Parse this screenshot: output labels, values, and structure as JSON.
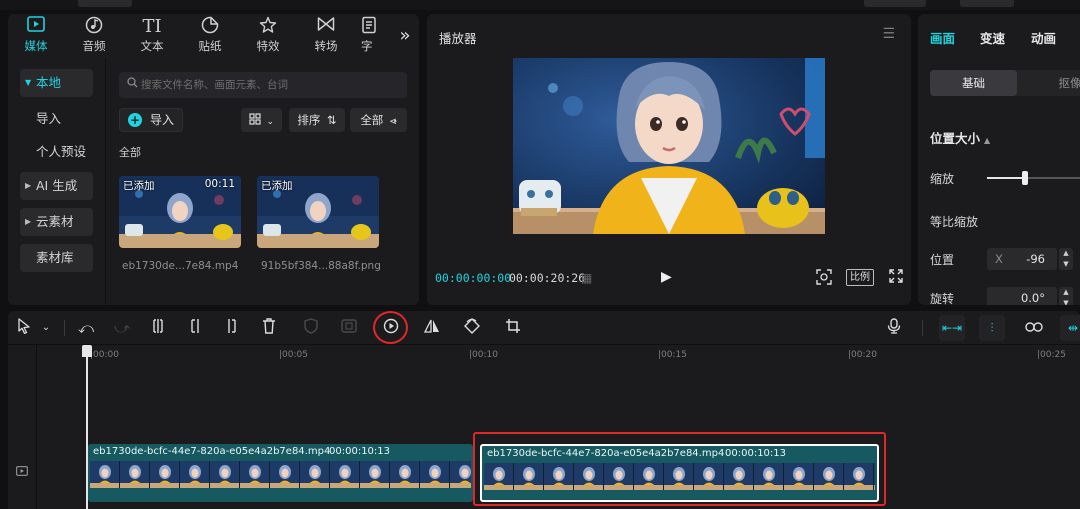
{
  "media_panel": {
    "tabs": [
      {
        "label": "媒体",
        "icon": "media-icon",
        "active": true
      },
      {
        "label": "音频",
        "icon": "audio-icon"
      },
      {
        "label": "文本",
        "icon": "text-icon"
      },
      {
        "label": "贴纸",
        "icon": "sticker-icon"
      },
      {
        "label": "特效",
        "icon": "effects-icon"
      },
      {
        "label": "转场",
        "icon": "transition-icon"
      },
      {
        "label": "字",
        "icon": "caption-icon"
      }
    ],
    "sidebar": [
      {
        "label": "本地",
        "active": true
      },
      {
        "label": "导入"
      },
      {
        "label": "个人预设"
      },
      {
        "label": "AI 生成"
      },
      {
        "label": "云素材"
      },
      {
        "label": "素材库"
      }
    ],
    "search_placeholder": "搜索文件名称、画面元素、台词",
    "import_label": "导入",
    "sort_label": "排序",
    "filter_label": "全部",
    "section_label": "全部",
    "items": [
      {
        "tag": "已添加",
        "duration": "00:11",
        "filename": "eb1730de...7e84.mp4"
      },
      {
        "tag": "已添加",
        "duration": "",
        "filename": "91b5bf384...88a8f.png"
      }
    ]
  },
  "player": {
    "title": "播放器",
    "current_time": "00:00:00:00",
    "total_time": "00:00:20:26",
    "ratio_label": "比例"
  },
  "inspector": {
    "tabs": [
      "画面",
      "变速",
      "动画"
    ],
    "subtabs": [
      "基础",
      "抠像"
    ],
    "section_title": "位置大小",
    "scale_label": "缩放",
    "scale_value_fraction": 0.38,
    "uniform_scale_label": "等比缩放",
    "position_label": "位置",
    "position_x_key": "X",
    "position_x_value": "-96",
    "rotation_label": "旋转",
    "rotation_value": "0.0°"
  },
  "toolbar": {
    "tools": [
      "select-icon",
      "undo-icon",
      "redo-icon",
      "split-icon",
      "split-left-icon",
      "split-right-icon",
      "delete-icon",
      "freeze-icon",
      "mask-icon",
      "speed-play-icon",
      "mirror-icon",
      "rotate-icon",
      "crop-icon",
      "mic-icon",
      "main-track-magnet-icon",
      "auto-snap-icon",
      "link-icon",
      "preview-axis-icon"
    ]
  },
  "timeline": {
    "ticks": [
      "|00:00",
      "|00:05",
      "|00:10",
      "|00:15",
      "|00:20",
      "|00:25"
    ],
    "clips": [
      {
        "name": "eb1730de-bcfc-44e7-820a-e05e4a2b7e84.mp4",
        "duration": "00:00:10:13",
        "selected": false
      },
      {
        "name": "eb1730de-bcfc-44e7-820a-e05e4a2b7e84.mp4",
        "duration": "00:00:10:13",
        "selected": true
      }
    ]
  },
  "colors": {
    "accent": "#1fd3e0",
    "highlight": "#e0282a",
    "clip": "#165960"
  }
}
